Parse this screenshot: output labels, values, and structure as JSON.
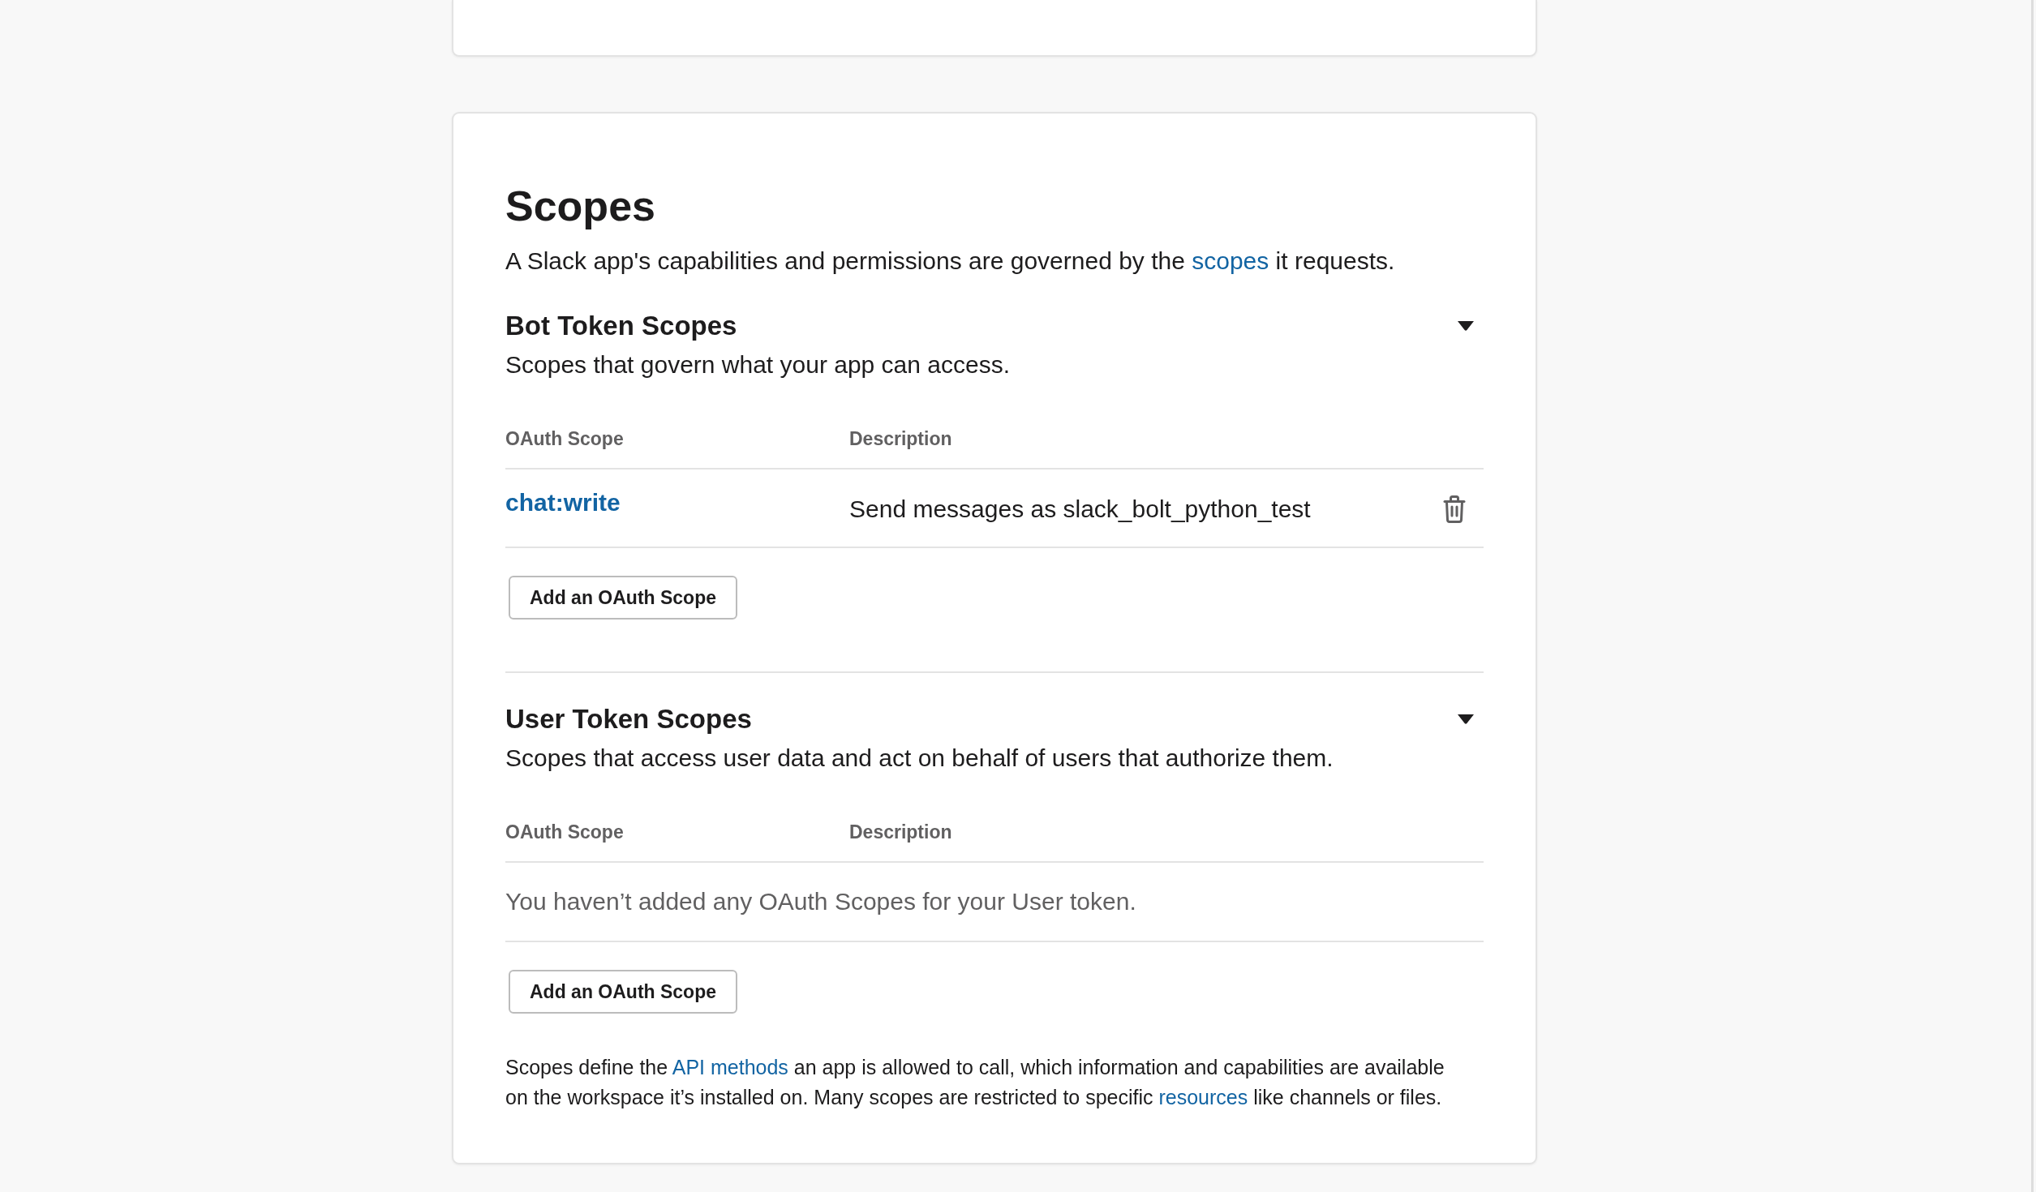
{
  "scopes_card": {
    "title": "Scopes",
    "intro": [
      {
        "kind": "text",
        "text": "A Slack app's capabilities and permissions are governed by the "
      },
      {
        "kind": "link",
        "text": "scopes"
      },
      {
        "kind": "text",
        "text": " it requests."
      }
    ],
    "sections": [
      {
        "title": "Bot Token Scopes",
        "subtitle": "Scopes that govern what your app can access.",
        "expanded": true,
        "columns": [
          "OAuth Scope",
          "Description"
        ],
        "rows": [
          {
            "scope": "chat:write",
            "description": "Send messages as slack_bolt_python_test"
          }
        ],
        "add_button": "Add an OAuth Scope"
      },
      {
        "title": "User Token Scopes",
        "subtitle": "Scopes that access user data and act on behalf of users that authorize them.",
        "expanded": true,
        "columns": [
          "OAuth Scope",
          "Description"
        ],
        "empty_message": "You haven’t added any OAuth Scopes for your User token.",
        "add_button": "Add an OAuth Scope"
      }
    ],
    "footer": [
      {
        "kind": "text",
        "text": "Scopes define the "
      },
      {
        "kind": "link",
        "text": "API methods"
      },
      {
        "kind": "text",
        "text": " an app is allowed to call, which information and capabilities are available on the workspace it’s installed on. Many scopes are restricted to specific "
      },
      {
        "kind": "link",
        "text": "resources"
      },
      {
        "kind": "text",
        "text": " like channels or files."
      }
    ]
  }
}
